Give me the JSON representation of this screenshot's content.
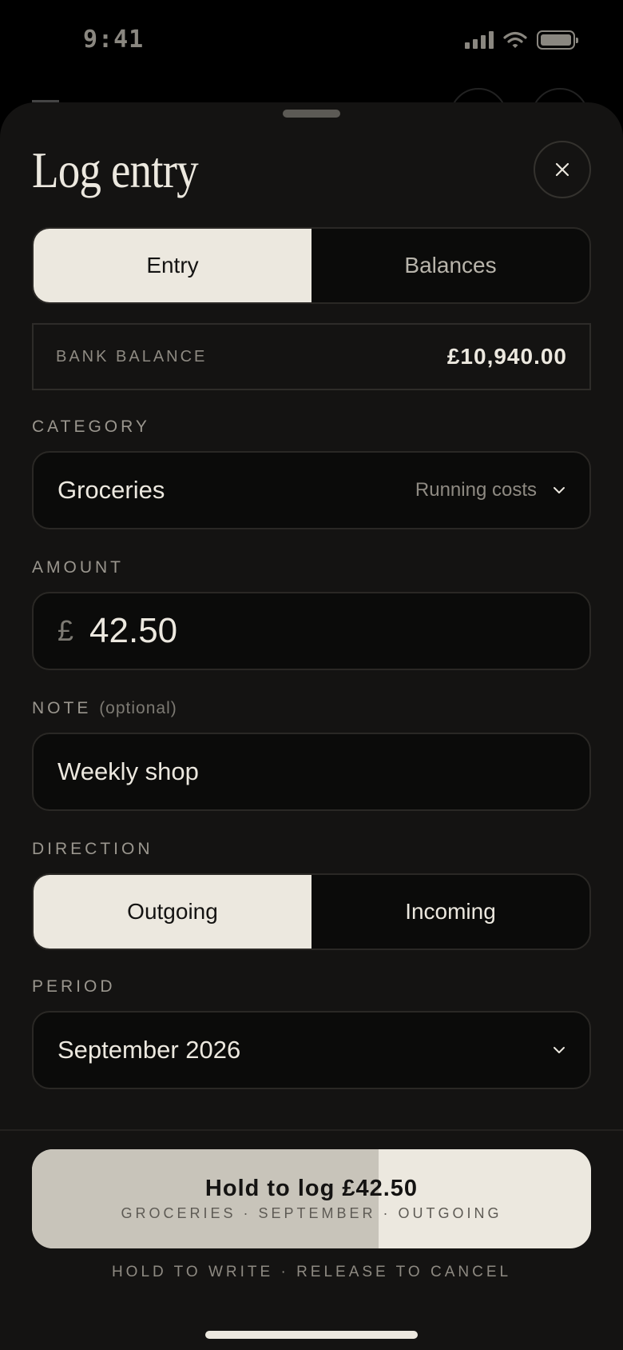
{
  "status_bar": {
    "time": "9:41"
  },
  "sheet": {
    "title": "Log entry",
    "tabs": [
      {
        "label": "Entry",
        "active": true
      },
      {
        "label": "Balances",
        "active": false
      }
    ],
    "bank_balance": {
      "label": "BANK BALANCE",
      "value": "£10,940.00"
    },
    "category": {
      "label": "CATEGORY",
      "value": "Groceries",
      "group": "Running costs"
    },
    "amount": {
      "label": "AMOUNT",
      "currency": "£",
      "value": "42.50"
    },
    "note": {
      "label": "NOTE",
      "optional": "(optional)",
      "value": "Weekly shop"
    },
    "direction": {
      "label": "DIRECTION",
      "options": [
        {
          "label": "Outgoing",
          "active": true
        },
        {
          "label": "Incoming",
          "active": false
        }
      ]
    },
    "period": {
      "label": "PERIOD",
      "value": "September 2026"
    },
    "hold_button": {
      "title": "Hold to log £42.50",
      "subtitle": "GROCERIES · SEPTEMBER · OUTGOING",
      "progress": 0.62
    },
    "hint": "HOLD TO WRITE · RELEASE TO CANCEL"
  },
  "icons": {
    "close": "close-icon",
    "chevron": "chevron-down-icon",
    "signal": "cellular-signal-icon",
    "wifi": "wifi-icon",
    "battery": "battery-icon"
  },
  "colors": {
    "background": "#000000",
    "sheet": "#141312",
    "field": "#0b0b0a",
    "accent": "#ece8df",
    "progress": "#c8c4ba",
    "muted_text": "#8e8a82"
  }
}
